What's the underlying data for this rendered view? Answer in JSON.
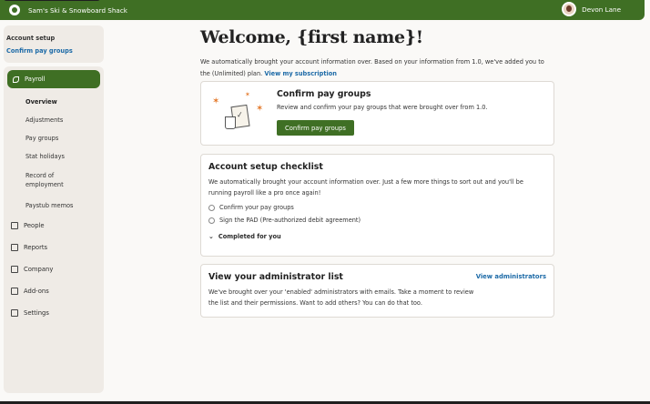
{
  "topbar": {
    "brand": "Sam's Ski & Snowboard Shack",
    "user_name": "Devon Lane"
  },
  "setup_panel": {
    "title": "Account setup",
    "link": "Confirm pay groups"
  },
  "sidebar": {
    "active": "Payroll",
    "sub_items": [
      {
        "label": "Overview"
      },
      {
        "label": "Adjustments"
      },
      {
        "label": "Pay groups"
      },
      {
        "label": "Stat holidays"
      },
      {
        "label": "Record of employment"
      },
      {
        "label": "Paystub memos"
      }
    ],
    "items": [
      {
        "label": "People"
      },
      {
        "label": "Reports"
      },
      {
        "label": "Company"
      },
      {
        "label": "Add-ons"
      },
      {
        "label": "Settings"
      }
    ]
  },
  "main": {
    "title": "Welcome, {first name}!",
    "intro": "We automatically brought your account information over. Based on your information from 1.0, we've added you to the (Unlimited) plan.",
    "intro_link": "View my subscription"
  },
  "confirm_card": {
    "title": "Confirm pay groups",
    "text": "Review and confirm your pay groups that were brought over from 1.0.",
    "button": "Confirm pay groups"
  },
  "checklist": {
    "title": "Account setup checklist",
    "text": "We automatically brought your account information over. Just a few more things to sort out and you'll be running payroll like a pro once again!",
    "items": [
      {
        "label": "Confirm your pay groups"
      },
      {
        "label": "Sign the PAD (Pre-authorized debit agreement)"
      }
    ],
    "completed": "Completed for you"
  },
  "admin_card": {
    "title": "View your administrator list",
    "link": "View administrators",
    "text": "We've brought over your 'enabled' administrators with emails. Take a moment to review the list and their permissions.  Want to add others? You can do that too."
  }
}
